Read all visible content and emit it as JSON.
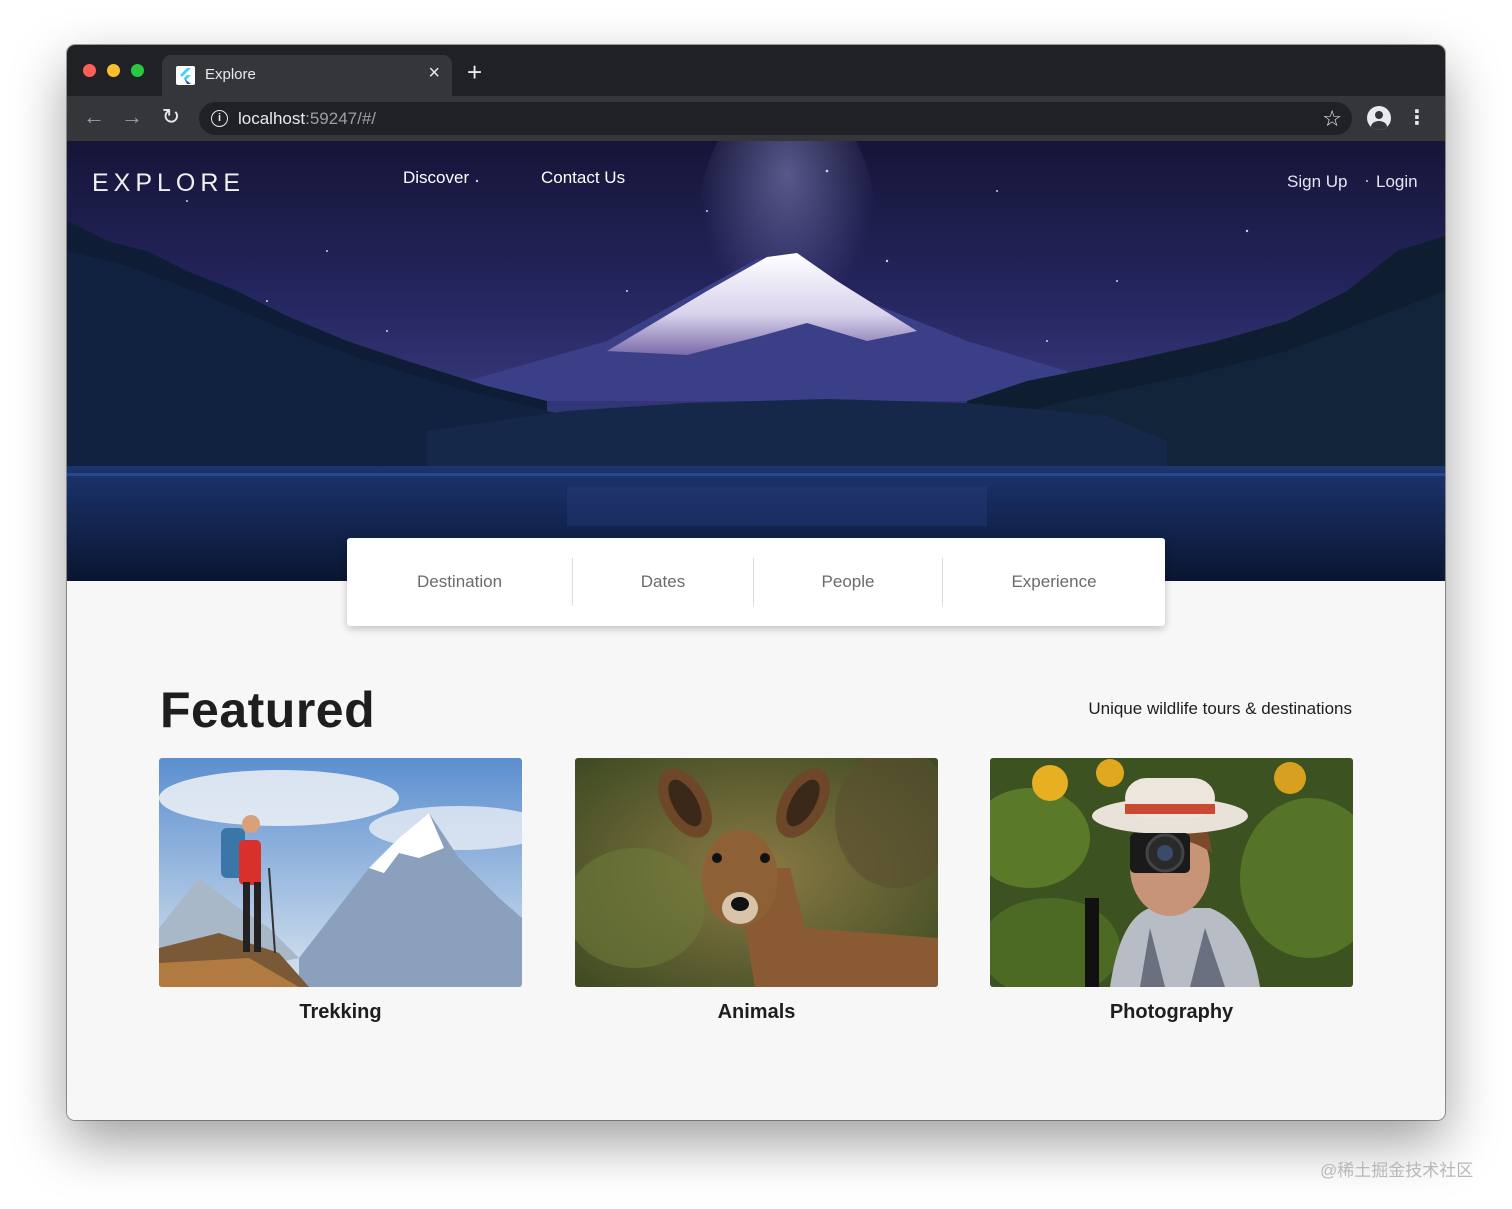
{
  "browser": {
    "tab_title": "Explore",
    "tab_close": "×",
    "new_tab": "+",
    "back": "←",
    "forward": "→",
    "reload": "↻",
    "url_host": "localhost",
    "url_rest": ":59247/#/",
    "info": "i",
    "star": "☆",
    "menu": "⋮"
  },
  "header": {
    "brand": "EXPLORE",
    "nav": [
      "Discover",
      "Contact Us"
    ],
    "auth": [
      "Sign Up",
      "Login"
    ]
  },
  "search": {
    "fields": [
      "Destination",
      "Dates",
      "People",
      "Experience"
    ]
  },
  "featured": {
    "title": "Featured",
    "subtitle": "Unique wildlife tours & destinations",
    "cards": [
      {
        "label": "Trekking"
      },
      {
        "label": "Animals"
      },
      {
        "label": "Photography"
      }
    ]
  },
  "colors": {
    "tabbar": "#202124",
    "toolbar": "#35363a",
    "page_bg": "#f7f7f7",
    "text_dark": "#1e1e1e"
  },
  "icons": [
    "flutter-favicon-icon",
    "close-icon",
    "plus-icon",
    "arrow-left-icon",
    "arrow-right-icon",
    "reload-icon",
    "info-icon",
    "star-icon",
    "profile-icon",
    "more-vert-icon"
  ],
  "watermark": "@稀土掘金技术社区"
}
